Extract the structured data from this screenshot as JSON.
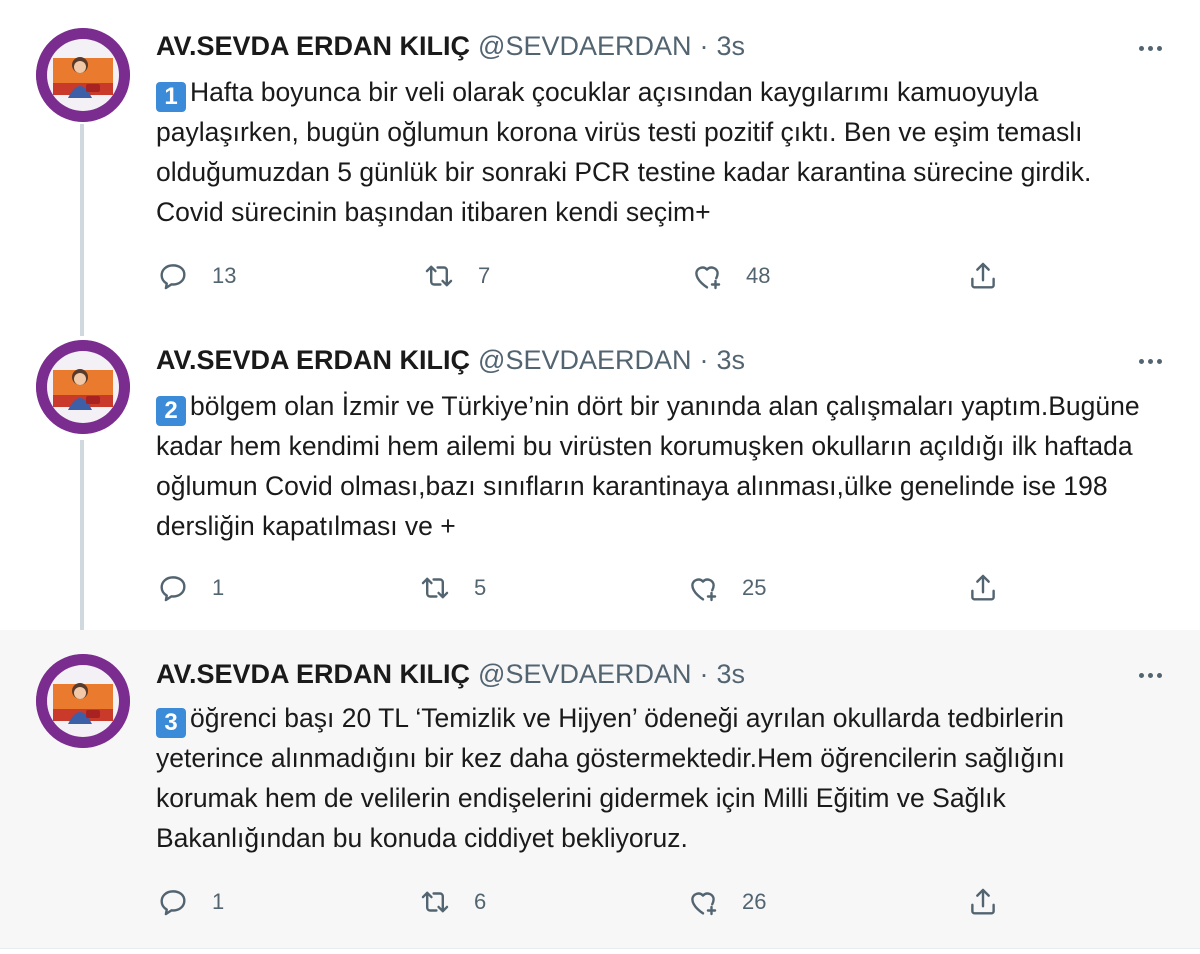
{
  "tweets": [
    {
      "author_name": "AV.SEVDA ERDAN KILIÇ",
      "handle": "@SEVDAERDAN",
      "separator": "·",
      "time": "3s",
      "number": "1",
      "text": "Hafta boyunca bir veli olarak çocuklar açısından kaygılarımı kamuoyuyla paylaşırken, bugün oğlumun korona virüs testi pozitif çıktı. Ben ve eşim temaslı olduğumuzdan 5 günlük bir sonraki PCR testine kadar karantina sürecine girdik. Covid sürecinin başından itibaren kendi seçim+",
      "replies": "13",
      "retweets": "7",
      "likes": "48"
    },
    {
      "author_name": "AV.SEVDA ERDAN KILIÇ",
      "handle": "@SEVDAERDAN",
      "separator": "·",
      "time": "3s",
      "number": "2",
      "text": "bölgem olan İzmir ve Türkiye’nin dört bir yanında alan çalışmaları yaptım.Bugüne kadar hem kendimi hem ailemi bu virüsten korumuşken okulların açıldığı ilk haftada oğlumun Covid olması,bazı sınıfların karantinaya alınması,ülke genelinde ise 198 dersliğin kapatılması ve +",
      "replies": "1",
      "retweets": "5",
      "likes": "25"
    },
    {
      "author_name": "AV.SEVDA ERDAN KILIÇ",
      "handle": "@SEVDAERDAN",
      "separator": "·",
      "time": "3s",
      "number": "3",
      "text": "öğrenci başı 20 TL ‘Temizlik ve Hijyen’ ödeneği ayrılan okullarda tedbirlerin yeterince alınmadığını bir kez daha göstermektedir.Hem öğrencilerin sağlığını korumak hem de velilerin endişelerini gidermek için Milli Eğitim ve Sağlık Bakanlığından bu konuda ciddiyet bekliyoruz.",
      "replies": "1",
      "retweets": "6",
      "likes": "26"
    }
  ],
  "icons": {
    "reply": "reply-icon",
    "retweet": "retweet-icon",
    "like": "like-icon",
    "share": "share-icon",
    "more": "more-icon"
  },
  "colors": {
    "text_secondary": "#536471",
    "keycap_blue": "#3b8bd9",
    "thread_line": "#cfd9de",
    "avatar_ring": "#7b2d8f",
    "highlight_bg": "#f7f7f7"
  }
}
